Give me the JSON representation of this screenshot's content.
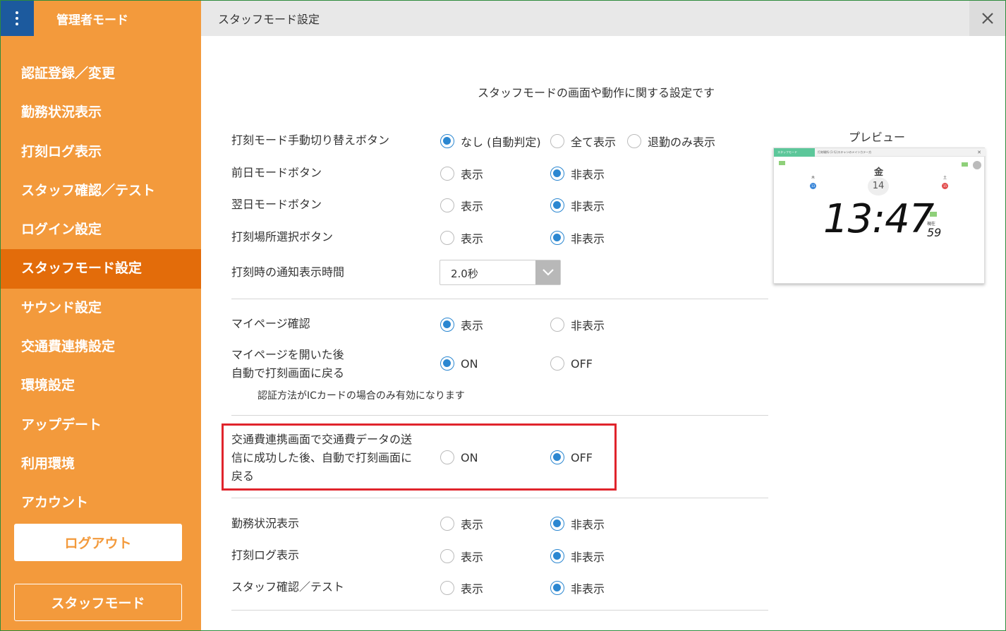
{
  "sidebar": {
    "admin_title": "管理者モード",
    "items": [
      {
        "label": "認証登録／変更",
        "active": false
      },
      {
        "label": "勤務状況表示",
        "active": false
      },
      {
        "label": "打刻ログ表示",
        "active": false
      },
      {
        "label": "スタッフ確認／テスト",
        "active": false
      },
      {
        "label": "ログイン設定",
        "active": false
      },
      {
        "label": "スタッフモード設定",
        "active": true
      },
      {
        "label": "サウンド設定",
        "active": false
      },
      {
        "label": "交通費連携設定",
        "active": false
      },
      {
        "label": "環境設定",
        "active": false
      },
      {
        "label": "アップデート",
        "active": false
      },
      {
        "label": "利用環境",
        "active": false
      },
      {
        "label": "アカウント",
        "active": false
      }
    ],
    "logout_label": "ログアウト",
    "staff_mode_label": "スタッフモード"
  },
  "header": {
    "title": "スタッフモード設定"
  },
  "intro": "スタッフモードの画面や動作に関する設定です",
  "settings": {
    "manual_switch": {
      "label": "打刻モード手動切り替えボタン",
      "options": [
        "なし (自動判定)",
        "全て表示",
        "退勤のみ表示"
      ],
      "selected": 0
    },
    "prev_day": {
      "label": "前日モードボタン",
      "options": [
        "表示",
        "非表示"
      ],
      "selected": 1
    },
    "next_day": {
      "label": "翌日モードボタン",
      "options": [
        "表示",
        "非表示"
      ],
      "selected": 1
    },
    "place_select": {
      "label": "打刻場所選択ボタン",
      "options": [
        "表示",
        "非表示"
      ],
      "selected": 1
    },
    "notify_time": {
      "label": "打刻時の通知表示時間",
      "value": "2.0秒"
    },
    "mypage": {
      "label": "マイページ確認",
      "options": [
        "表示",
        "非表示"
      ],
      "selected": 0
    },
    "mypage_return": {
      "label_line1": "マイページを開いた後",
      "label_line2": "自動で打刻画面に戻る",
      "options": [
        "ON",
        "OFF"
      ],
      "selected": 0,
      "note": "認証方法がICカードの場合のみ有効になります"
    },
    "transport_return": {
      "label_line1": "交通費連携画面で交通費データの送",
      "label_line2": "信に成功した後、自動で打刻画面に",
      "label_line3": "戻る",
      "options": [
        "ON",
        "OFF"
      ],
      "selected": 1
    },
    "work_status": {
      "label": "勤務状況表示",
      "options": [
        "表示",
        "非表示"
      ],
      "selected": 1
    },
    "log_view": {
      "label": "打刻ログ表示",
      "options": [
        "表示",
        "非表示"
      ],
      "selected": 1
    },
    "staff_check": {
      "label": "スタッフ確認／テスト",
      "options": [
        "表示",
        "非表示"
      ],
      "selected": 1
    }
  },
  "preview": {
    "label": "プレビュー",
    "tab_label": "スタッフモード",
    "window_title": "打刻場所 (1 行)スキャンのメインカテ一方",
    "weekday_left": "木",
    "day_left": "13",
    "weekday": "金",
    "date": "14",
    "weekday_right": "土",
    "day_right": "15",
    "time": "13:47",
    "seconds_label": "現在",
    "seconds": "59"
  },
  "colors": {
    "sidebar": "#f39a3c",
    "sidebar_active": "#e36c0a",
    "accent": "#2b87d1",
    "highlight": "#e0242c"
  }
}
